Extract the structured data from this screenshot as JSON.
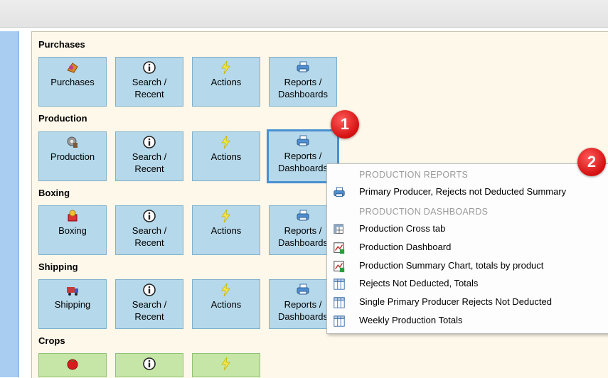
{
  "sections": [
    {
      "key": "purchases",
      "label": "Purchases",
      "tiles": [
        {
          "icon": "purchases-icon",
          "label": "Purchases"
        },
        {
          "icon": "info-icon",
          "label": "Search /\nRecent"
        },
        {
          "icon": "lightning-icon",
          "label": "Actions"
        },
        {
          "icon": "printer-icon",
          "label": "Reports /\nDashboards"
        }
      ]
    },
    {
      "key": "production",
      "label": "Production",
      "tiles": [
        {
          "icon": "production-icon",
          "label": "Production"
        },
        {
          "icon": "info-icon",
          "label": "Search /\nRecent"
        },
        {
          "icon": "lightning-icon",
          "label": "Actions"
        },
        {
          "icon": "printer-icon",
          "label": "Reports /\nDashboards"
        }
      ]
    },
    {
      "key": "boxing",
      "label": "Boxing",
      "tiles": [
        {
          "icon": "boxing-icon",
          "label": "Boxing"
        },
        {
          "icon": "info-icon",
          "label": "Search /\nRecent"
        },
        {
          "icon": "lightning-icon",
          "label": "Actions"
        },
        {
          "icon": "printer-icon",
          "label": "Reports /\nDashboards"
        }
      ]
    },
    {
      "key": "shipping",
      "label": "Shipping",
      "tiles": [
        {
          "icon": "shipping-icon",
          "label": "Shipping"
        },
        {
          "icon": "info-icon",
          "label": "Search /\nRecent"
        },
        {
          "icon": "lightning-icon",
          "label": "Actions"
        },
        {
          "icon": "printer-icon",
          "label": "Reports /\nDashboards"
        }
      ]
    },
    {
      "key": "crops",
      "label": "Crops",
      "tiles": [
        {
          "icon": "tomato-icon",
          "label": ""
        },
        {
          "icon": "info-icon",
          "label": ""
        },
        {
          "icon": "lightning-icon",
          "label": ""
        }
      ]
    }
  ],
  "badges": {
    "one": "1",
    "two": "2"
  },
  "menu": {
    "reports_header": "PRODUCTION  REPORTS",
    "dashboards_header": "PRODUCTION  DASHBOARDS",
    "items": [
      {
        "icon": "printer-icon",
        "label": "Primary Producer, Rejects not Deducted Summary"
      },
      {
        "icon": "cross-tab-icon",
        "label": "Production Cross tab"
      },
      {
        "icon": "dashboard-chart-icon",
        "label": "Production Dashboard"
      },
      {
        "icon": "dashboard-chart-icon",
        "label": "Production Summary Chart, totals by product"
      },
      {
        "icon": "grid-icon",
        "label": "Rejects Not Deducted, Totals"
      },
      {
        "icon": "grid-icon",
        "label": "Single Primary Producer Rejects Not Deducted"
      },
      {
        "icon": "grid-icon",
        "label": "Weekly Production Totals"
      }
    ]
  },
  "colors": {
    "tile_blue": "#b5d8ea",
    "tile_green": "#c5e6a6",
    "panel": "#fdf8ea",
    "badge_red": "#d40f0f",
    "selected_border": "#4a8fd0"
  }
}
